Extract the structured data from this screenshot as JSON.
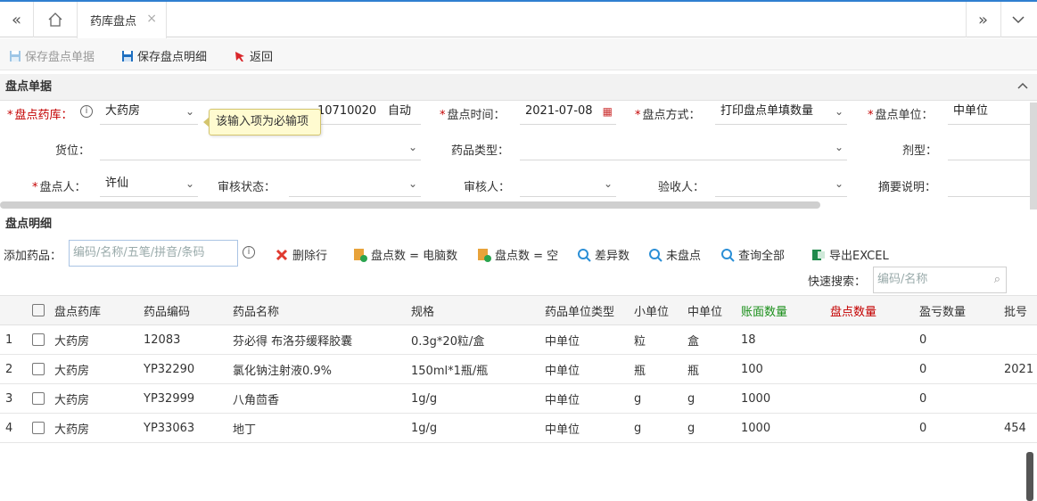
{
  "tabs": {
    "home_icon": "home-icon",
    "active_tab": "药库盘点"
  },
  "toolbar": {
    "save_bill": "保存盘点单据",
    "save_detail": "保存盘点明细",
    "back": "返回"
  },
  "bill_section": {
    "title": "盘点单据"
  },
  "form": {
    "warehouse_label": "盘点药库：",
    "warehouse_value": "大药房",
    "tooltip": "该输入项为必输项",
    "bill_no_value": "10710020",
    "bill_no_mode": "自动",
    "time_label": "盘点时间：",
    "time_value": "2021-07-08",
    "method_label": "盘点方式：",
    "method_value": "打印盘点单填数量",
    "unit_label": "盘点单位：",
    "unit_value": "中单位",
    "location_label": "货位：",
    "drug_type_label": "药品类型：",
    "dosage_label": "剂型：",
    "person_label": "盘点人：",
    "person_value": "许仙",
    "audit_status_label": "审核状态：",
    "auditor_label": "审核人：",
    "receiver_label": "验收人：",
    "summary_label": "摘要说明："
  },
  "detail_section": {
    "title": "盘点明细"
  },
  "detail_toolbar": {
    "add_drug_label": "添加药品：",
    "add_drug_placeholder": "编码/名称/五笔/拼音/条码",
    "delete_row": "删除行",
    "count_eq_computer": "盘点数 = 电脑数",
    "count_eq_empty": "盘点数 = 空",
    "diff_count": "差异数",
    "not_counted": "未盘点",
    "query_all": "查询全部",
    "export_excel": "导出EXCEL",
    "quick_search_label": "快速搜索：",
    "quick_search_placeholder": "编码/名称"
  },
  "table": {
    "columns": [
      "盘点药库",
      "药品编码",
      "药品名称",
      "规格",
      "药品单位类型",
      "小单位",
      "中单位",
      "账面数量",
      "盘点数量",
      "盈亏数量",
      "批号"
    ],
    "rows": [
      {
        "n": "1",
        "warehouse": "大药房",
        "code": "12083",
        "name": "芬必得 布洛芬缓释胶囊",
        "spec": "0.3g*20粒/盒",
        "unit_type": "中单位",
        "small": "粒",
        "mid": "盒",
        "book": "18",
        "count": "",
        "diff": "0",
        "batch": ""
      },
      {
        "n": "2",
        "warehouse": "大药房",
        "code": "YP32290",
        "name": "氯化钠注射液0.9%",
        "spec": "150ml*1瓶/瓶",
        "unit_type": "中单位",
        "small": "瓶",
        "mid": "瓶",
        "book": "100",
        "count": "",
        "diff": "0",
        "batch": "2021"
      },
      {
        "n": "3",
        "warehouse": "大药房",
        "code": "YP32999",
        "name": "八角茴香",
        "spec": "1g/g",
        "unit_type": "中单位",
        "small": "g",
        "mid": "g",
        "book": "1000",
        "count": "",
        "diff": "0",
        "batch": ""
      },
      {
        "n": "4",
        "warehouse": "大药房",
        "code": "YP33063",
        "name": "地丁",
        "spec": "1g/g",
        "unit_type": "中单位",
        "small": "g",
        "mid": "g",
        "book": "1000",
        "count": "",
        "diff": "0",
        "batch": "454"
      }
    ]
  }
}
